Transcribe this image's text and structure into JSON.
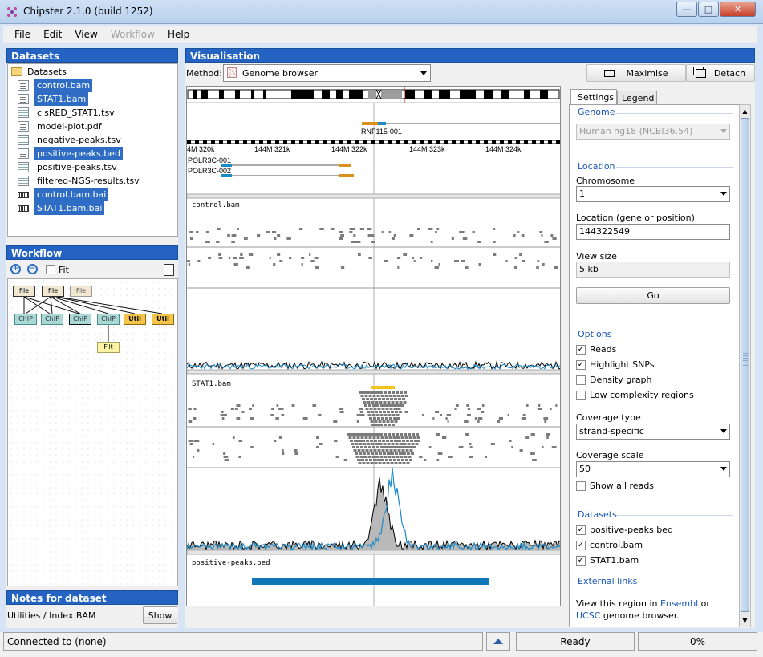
{
  "window": {
    "title": "Chipster 2.1.0 (build 1252)",
    "minimize": "—",
    "maximize": "□",
    "close": "✕"
  },
  "menu": [
    {
      "label": "File",
      "enabled": true
    },
    {
      "label": "Edit",
      "enabled": true
    },
    {
      "label": "View",
      "enabled": true
    },
    {
      "label": "Workflow",
      "enabled": false
    },
    {
      "label": "Help",
      "enabled": true
    }
  ],
  "datasets": {
    "header": "Datasets",
    "root": "Datasets",
    "items": [
      {
        "label": "control.bam",
        "icon": "document-icon",
        "selected": true
      },
      {
        "label": "STAT1.bam",
        "icon": "document-icon",
        "selected": true
      },
      {
        "label": "cisRED_STAT1.tsv",
        "icon": "table-icon",
        "selected": false
      },
      {
        "label": "model-plot.pdf",
        "icon": "image-icon",
        "selected": false
      },
      {
        "label": "negative-peaks.tsv",
        "icon": "table-icon",
        "selected": false
      },
      {
        "label": "positive-peaks.bed",
        "icon": "document-icon",
        "selected": true
      },
      {
        "label": "positive-peaks.tsv",
        "icon": "table-icon",
        "selected": false
      },
      {
        "label": "filtered-NGS-results.tsv",
        "icon": "table-icon",
        "selected": false
      },
      {
        "label": "control.bam.bai",
        "icon": "index-icon",
        "selected": true
      },
      {
        "label": "STAT1.bam.bai",
        "icon": "index-icon",
        "selected": true
      }
    ]
  },
  "workflow": {
    "header": "Workflow",
    "fit_label": "Fit",
    "nodes": {
      "file1": "file",
      "file2": "file",
      "file3": "file",
      "chip1": "ChIP",
      "chip2": "ChIP",
      "chip3": "ChIP",
      "chip4": "ChIP",
      "util1": "Util",
      "util2": "Util",
      "filt": "Filt"
    }
  },
  "notes": {
    "header": "Notes for dataset",
    "text": "Utilities / Index BAM",
    "show_button": "Show"
  },
  "visualisation": {
    "header": "Visualisation",
    "method_label": "Method:",
    "method_value": "Genome browser",
    "maximise": "Maximise",
    "detach": "Detach",
    "gene_label": "RNF115-001",
    "ruler_labels": [
      "4M 320k",
      "144M 321k",
      "144M 322k",
      "144M 323k",
      "144M 324k"
    ],
    "transcripts": [
      "POLR3C-001",
      "POLR3C-002"
    ],
    "tracks": [
      "control.bam",
      "STAT1.bam",
      "positive-peaks.bed"
    ]
  },
  "settings": {
    "tabs": [
      "Settings",
      "Legend"
    ],
    "genome_section": "Genome",
    "genome_value": "Human hg18 (NCBI36.54)",
    "location_section": "Location",
    "chromosome_label": "Chromosome",
    "chromosome_value": "1",
    "location_label": "Location (gene or position)",
    "location_value": "144322549",
    "viewsize_label": "View size",
    "viewsize_value": "5 kb",
    "go_button": "Go",
    "options_section": "Options",
    "options": [
      {
        "label": "Reads",
        "checked": true
      },
      {
        "label": "Highlight SNPs",
        "checked": true
      },
      {
        "label": "Density graph",
        "checked": false
      },
      {
        "label": "Low complexity regions",
        "checked": false
      }
    ],
    "coverage_type_label": "Coverage type",
    "coverage_type_value": "strand-specific",
    "coverage_scale_label": "Coverage scale",
    "coverage_scale_value": "50",
    "show_all_reads": {
      "label": "Show all reads",
      "checked": false
    },
    "datasets_section": "Datasets",
    "datasets": [
      {
        "label": "positive-peaks.bed",
        "checked": true
      },
      {
        "label": "control.bam",
        "checked": true
      },
      {
        "label": "STAT1.bam",
        "checked": true
      }
    ],
    "external_section": "External links",
    "external_text_1": "View this region in",
    "ensembl": "Ensembl",
    "or": "or",
    "ucsc": "UCSC",
    "external_text_2": "genome browser."
  },
  "status": {
    "connection": "Connected to (none)",
    "state": "Ready",
    "progress": "0%"
  },
  "colors": {
    "accent": "#2463c2",
    "coverage_blue": "#1b8ac9",
    "gene_orange": "#d9901e",
    "read_gray": "#7b7b7b",
    "peak_bar": "#1177b8"
  }
}
